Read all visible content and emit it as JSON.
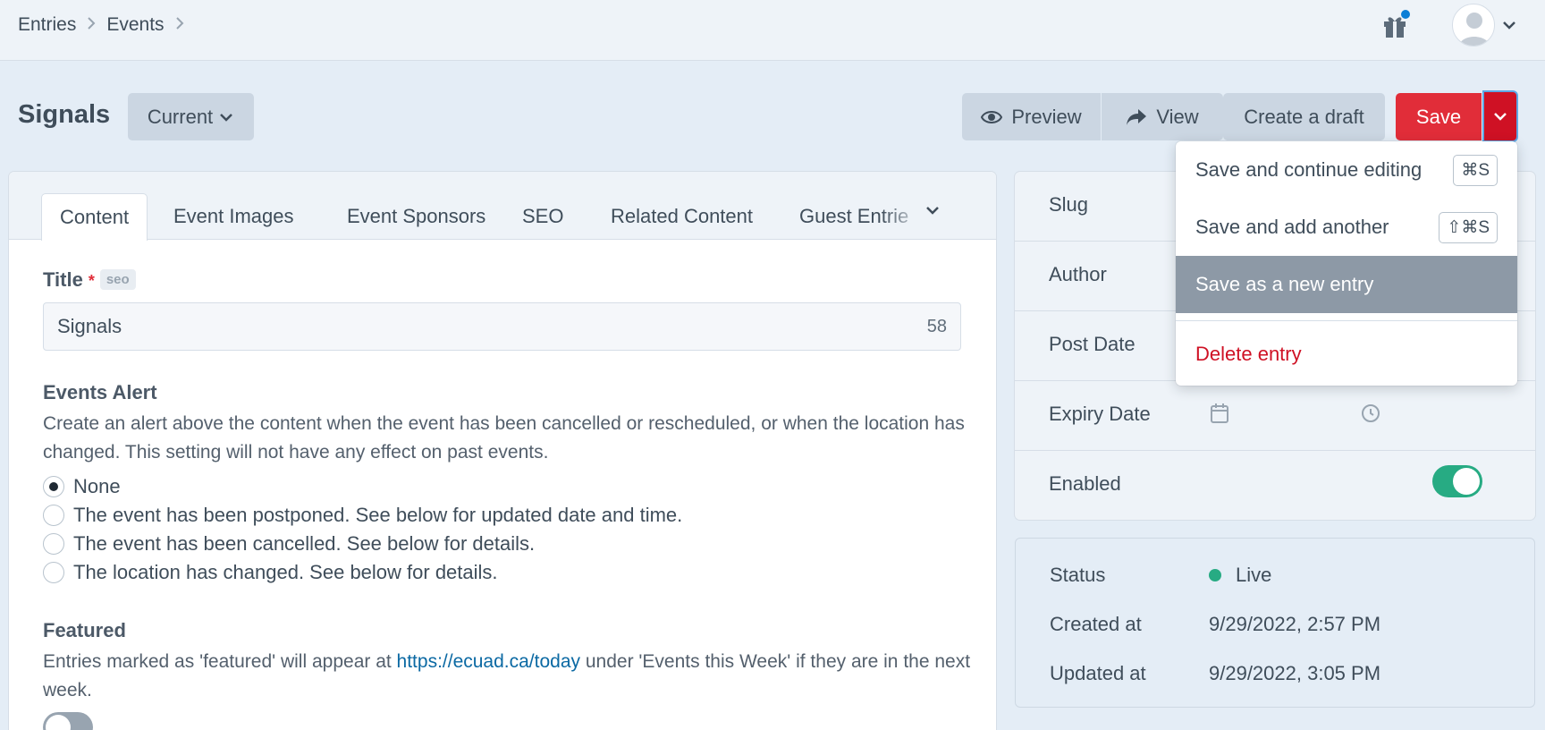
{
  "breadcrumb": [
    "Entries",
    "Events"
  ],
  "header": {
    "title": "Signals",
    "revision_label": "Current",
    "preview_label": "Preview",
    "view_label": "View",
    "create_draft_label": "Create a draft",
    "save_label": "Save"
  },
  "tabs": [
    "Content",
    "Event Images",
    "Event Sponsors",
    "SEO",
    "Related Content",
    "Guest Entrie"
  ],
  "fields": {
    "title_label": "Title",
    "title_required": "*",
    "title_badge": "seo",
    "title_value": "Signals",
    "title_char_count": "58",
    "alert_label": "Events Alert",
    "alert_instructions": "Create an alert above the content when the event has been cancelled or rescheduled, or when the location has changed. This setting will not have any effect on past events.",
    "alert_options": [
      "None",
      "The event has been postponed. See below for updated date and time.",
      "The event has been cancelled. See below for details.",
      "The location has changed. See below for details."
    ],
    "alert_selected": "None",
    "featured_label": "Featured",
    "featured_text_before": "Entries marked as 'featured' will appear at ",
    "featured_link": "https://ecuad.ca/today",
    "featured_text_after": " under 'Events this Week' if they are in the next week.",
    "featured_on": false
  },
  "meta": {
    "slug_label": "Slug",
    "author_label": "Author",
    "post_date_label": "Post Date",
    "expiry_date_label": "Expiry Date",
    "enabled_label": "Enabled",
    "enabled_on": true
  },
  "status": {
    "status_label": "Status",
    "status_value": "Live",
    "created_label": "Created at",
    "created_value": "9/29/2022, 2:57 PM",
    "updated_label": "Updated at",
    "updated_value": "9/29/2022, 3:05 PM"
  },
  "save_menu": {
    "items": [
      {
        "label": "Save and continue editing",
        "shortcut": "⌘S"
      },
      {
        "label": "Save and add another",
        "shortcut": "⇧⌘S"
      },
      {
        "label": "Save as a new entry",
        "shortcut": ""
      }
    ],
    "highlighted": "Save as a new entry",
    "delete_label": "Delete entry"
  },
  "colors": {
    "accent_red": "#e12d39",
    "link_blue": "#0b69a3",
    "toggle_green": "#27ab83",
    "live_green": "#27ab83"
  }
}
